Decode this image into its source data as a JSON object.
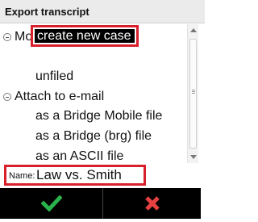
{
  "header": {
    "title": "Export transcript"
  },
  "tree": {
    "group1": {
      "label": "Move to case",
      "items": [
        "create new case",
        "unfiled"
      ]
    },
    "group2": {
      "label": "Attach to e-mail",
      "items": [
        "as a Bridge Mobile file",
        "as a Bridge (brg) file",
        "as an ASCII file"
      ]
    }
  },
  "name_field": {
    "label": "Name:",
    "value": "Law vs. Smith"
  },
  "colors": {
    "highlight": "#d8202a",
    "ok_icon": "#2bb24c",
    "cancel_icon": "#e54141",
    "button_bg": "#000000"
  },
  "icons": {
    "collapse": "circle-minus-icon",
    "ok": "checkmark-icon",
    "cancel": "x-icon"
  }
}
